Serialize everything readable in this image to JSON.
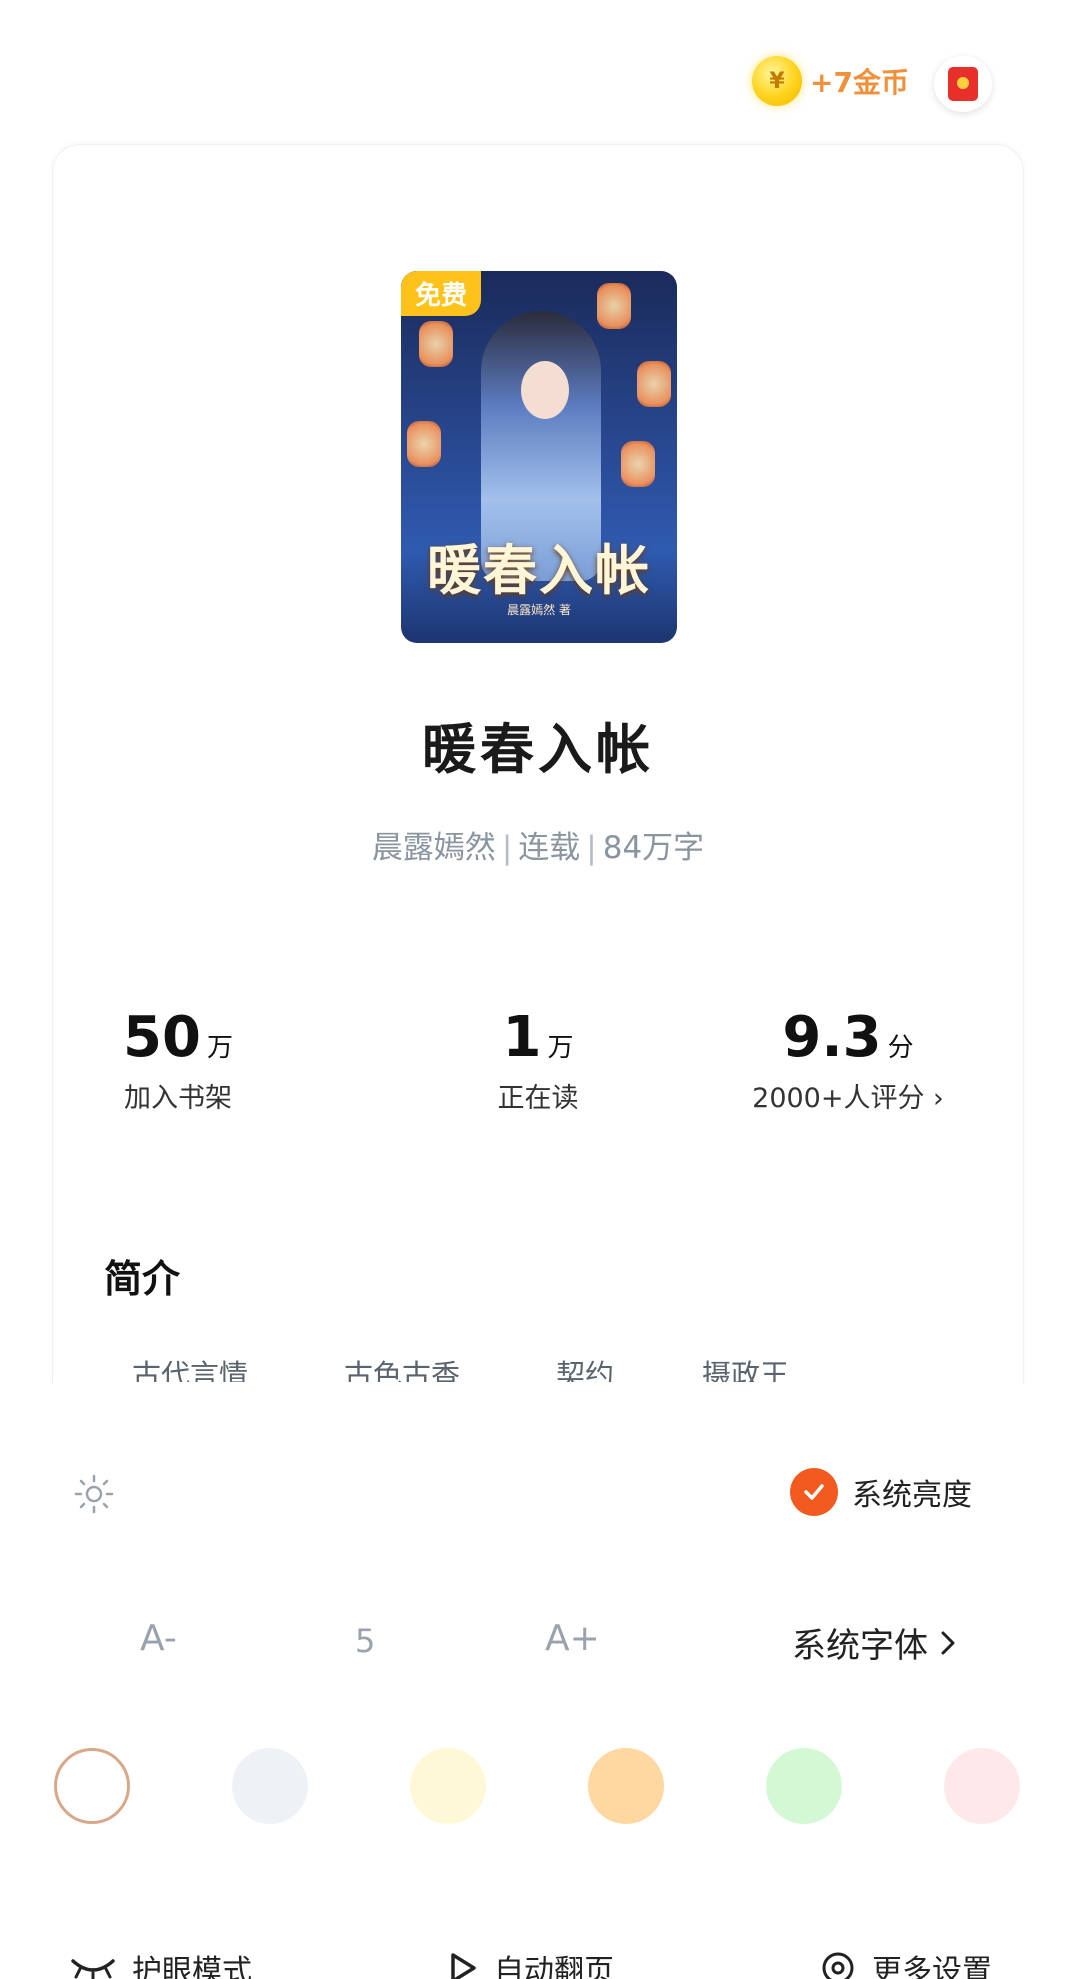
{
  "topbar": {
    "coin_symbol": "¥",
    "coin_reward": "+7金币",
    "redpacket_icon": "red-envelope-icon"
  },
  "book": {
    "free_badge": "免费",
    "cover_title": "暖春入帐",
    "cover_author": "晨露嫣然 著",
    "title": "暖春入帐",
    "author": "晨露嫣然",
    "status": "连载",
    "word_count": "84万字"
  },
  "stats": [
    {
      "num": "50",
      "unit": "万",
      "label": "加入书架"
    },
    {
      "num": "1",
      "unit": "万",
      "label": "正在读"
    },
    {
      "num": "9.3",
      "unit": "分",
      "label": "2000+人评分 ›"
    }
  ],
  "intro": {
    "heading": "简介",
    "tags": [
      "古代言情",
      "古色古香",
      "契约",
      "摄政王"
    ]
  },
  "settings": {
    "system_brightness": "系统亮度",
    "font_decrease": "A-",
    "font_size": "5",
    "font_increase": "A+",
    "system_font": "系统字体",
    "bg_colors": [
      "#ffffff",
      "#eef2f6",
      "#fff8d6",
      "#ffd7a0",
      "#d4f8d4",
      "#ffe8ea"
    ],
    "eye_care": "护眼模式",
    "auto_page": "自动翻页",
    "more_settings": "更多设置"
  }
}
